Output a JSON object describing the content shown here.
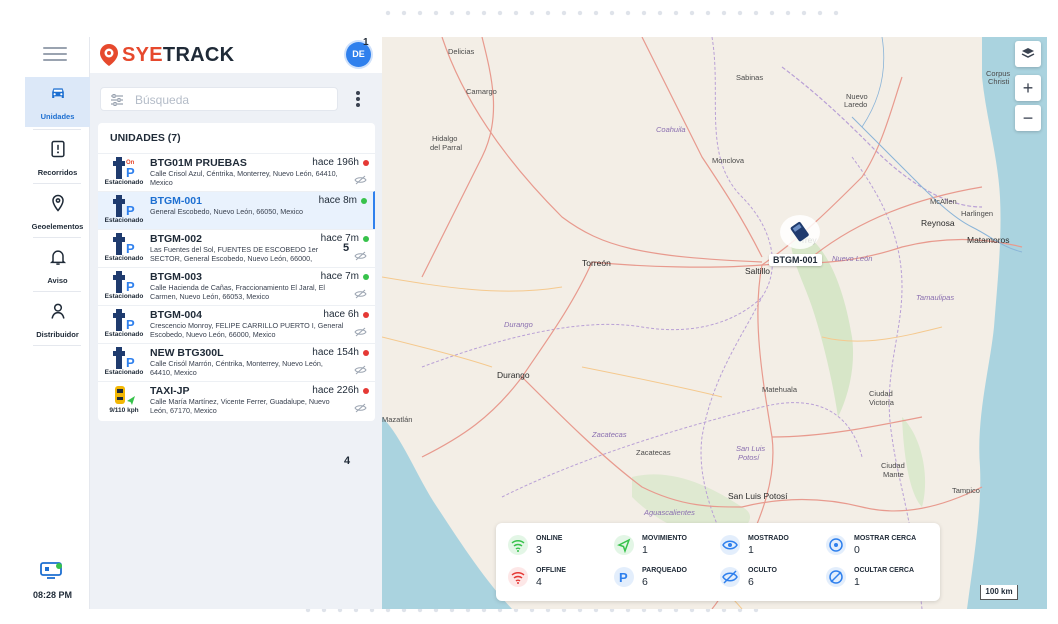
{
  "app": {
    "logo_text_a": "SYE",
    "logo_text_b": "TRACK"
  },
  "user": {
    "initials": "DE",
    "badge": "1"
  },
  "nav": {
    "items": [
      {
        "label": "Unidades",
        "icon": "car-icon"
      },
      {
        "label": "Recorridos",
        "icon": "route-icon"
      },
      {
        "label": "Geoelementos",
        "icon": "location-pin-icon"
      },
      {
        "label": "Aviso",
        "icon": "bell-icon"
      },
      {
        "label": "Distribuidor",
        "icon": "user-icon"
      }
    ],
    "time": "08:28 PM"
  },
  "search": {
    "placeholder": "Búsqueda"
  },
  "units": {
    "title": "UNIDADES (7)",
    "items": [
      {
        "name": "BTG01M PRUEBAS",
        "ago": "hace 196h",
        "status_color": "#e53935",
        "state": "Estacionado",
        "address": "Calle Crisol Azul, Céntrika, Monterrey, Nuevo León, 64410, Mexico"
      },
      {
        "name": "BTGM-001",
        "ago": "hace 8m",
        "status_color": "#37c24b",
        "state": "Estacionado",
        "address": "General Escobedo, Nuevo León, 66050, Mexico"
      },
      {
        "name": "BTGM-002",
        "ago": "hace 7m",
        "status_color": "#37c24b",
        "state": "Estacionado",
        "address": "Las Fuentes del Sol, FUENTES DE ESCOBEDO 1er SECTOR, General Escobedo, Nuevo León, 66000,"
      },
      {
        "name": "BTGM-003",
        "ago": "hace 7m",
        "status_color": "#37c24b",
        "state": "Estacionado",
        "address": "Calle Hacienda de Cañas, Fraccionamiento El Jaral, El Carmen, Nuevo León, 66053, Mexico"
      },
      {
        "name": "BTGM-004",
        "ago": "hace 6h",
        "status_color": "#e53935",
        "state": "Estacionado",
        "address": "Crescencio Monroy, FELIPE CARRILLO PUERTO I, General Escobedo, Nuevo León, 66000, Mexico"
      },
      {
        "name": "NEW BTG300L",
        "ago": "hace 154h",
        "status_color": "#e53935",
        "state": "Estacionado",
        "address": "Calle Crisól Marrón, Céntrika, Monterrey, Nuevo León, 64410, Mexico"
      },
      {
        "name": "TAXI-JP",
        "ago": "hace 226h",
        "status_color": "#e53935",
        "state": "9/110 kph",
        "address": "Calle María Martínez, Vicente Ferrer, Guadalupe, Nuevo León, 67170, Mexico"
      }
    ],
    "step_badge_5": "5",
    "step_badge_4": "4"
  },
  "map": {
    "marker_label": "BTGM-001",
    "scale": "100 km",
    "zoom_in": "+",
    "zoom_out": "−",
    "labels": {
      "delicias": "Delicias",
      "camargo": "Camargo",
      "hidalgo": "Hidalgo",
      "del_parral": "del Parral",
      "coahuila": "Coahuila",
      "sabinas": "Sabinas",
      "nuevo": "Nuevo",
      "laredo": "Laredo",
      "corpus": "Corpus",
      "christi": "Christi",
      "monclova": "Monclova",
      "mcallen": "McAllen",
      "harlingen": "Harlingen",
      "reynosa": "Reynosa",
      "matamoros": "Matamoros",
      "torreon": "Torreón",
      "saltillo": "Saltillo",
      "monterrey": "rrey",
      "nuevo_leon": "Nuevo León",
      "tamaulipas": "Tamaulipas",
      "durango_state": "Durango",
      "durango": "Durango",
      "matehuala": "Matehuala",
      "ciudad_victoria_a": "Ciudad",
      "ciudad_victoria_b": "Victoria",
      "mazatlan": "Mazatlán",
      "zacatecas_state": "Zacatecas",
      "zacatecas": "Zacatecas",
      "sanluis_state_a": "San Luis",
      "sanluis_state_b": "Potosí",
      "ciudad_mante_a": "Ciudad",
      "ciudad_mante_b": "Mante",
      "san_luis_potosi": "San Luis Potosí",
      "tampico": "Tampico",
      "aguascalientes": "Aguascalientes"
    }
  },
  "legend": {
    "online": {
      "title": "ONLINE",
      "value": "3"
    },
    "offline": {
      "title": "OFFLINE",
      "value": "4"
    },
    "movimiento": {
      "title": "MOVIMIENTO",
      "value": "1"
    },
    "parqueado": {
      "title": "PARQUEADO",
      "value": "6"
    },
    "mostrado": {
      "title": "MOSTRADO",
      "value": "1"
    },
    "oculto": {
      "title": "OCULTO",
      "value": "6"
    },
    "mostrar_cerca": {
      "title": "MOSTRAR CERCA",
      "value": "0"
    },
    "ocultar_cerca": {
      "title": "OCULTAR CERCA",
      "value": "1"
    }
  },
  "colors": {
    "primary": "#2f80ed",
    "online": "#37c24b",
    "offline": "#e53935",
    "brand_accent": "#e6492d"
  }
}
